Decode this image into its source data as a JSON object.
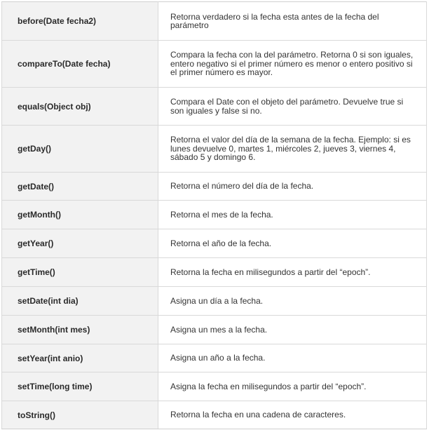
{
  "table": {
    "rows": [
      {
        "method": "before(Date fecha2)",
        "description": "Retorna verdadero si la fecha esta antes de la fecha del parámetro"
      },
      {
        "method": "compareTo(Date fecha)",
        "description": "Compara la fecha con la del parámetro. Retorna 0 si son iguales, entero negativo si el primer número es menor o entero positivo si el primer número es mayor."
      },
      {
        "method": "equals(Object obj)",
        "description": "Compara el Date con el objeto del parámetro. Devuelve true si son iguales y false si no."
      },
      {
        "method": "getDay()",
        "description": "Retorna el valor del día de la semana de la fecha. Ejemplo: si es lunes devuelve 0, martes 1, miércoles 2, jueves 3, viernes 4, sábado 5 y domingo 6."
      },
      {
        "method": "getDate()",
        "description": "Retorna el número del día de la fecha."
      },
      {
        "method": "getMonth()",
        "description": "Retorna el mes de la fecha."
      },
      {
        "method": "getYear()",
        "description": "Retorna el año de la fecha."
      },
      {
        "method": "getTime()",
        "description": "Retorna la fecha en milisegundos a partir del “epoch”."
      },
      {
        "method": "setDate(int dia)",
        "description": "Asigna un día a la fecha."
      },
      {
        "method": "setMonth(int mes)",
        "description": "Asigna un mes a la fecha."
      },
      {
        "method": "setYear(int anio)",
        "description": "Asigna un año a la fecha."
      },
      {
        "method": "setTime(long time)",
        "description": "Asigna la fecha en milisegundos a partir del “epoch”."
      },
      {
        "method": "toString()",
        "description": "Retorna la fecha en una cadena de caracteres."
      }
    ]
  }
}
